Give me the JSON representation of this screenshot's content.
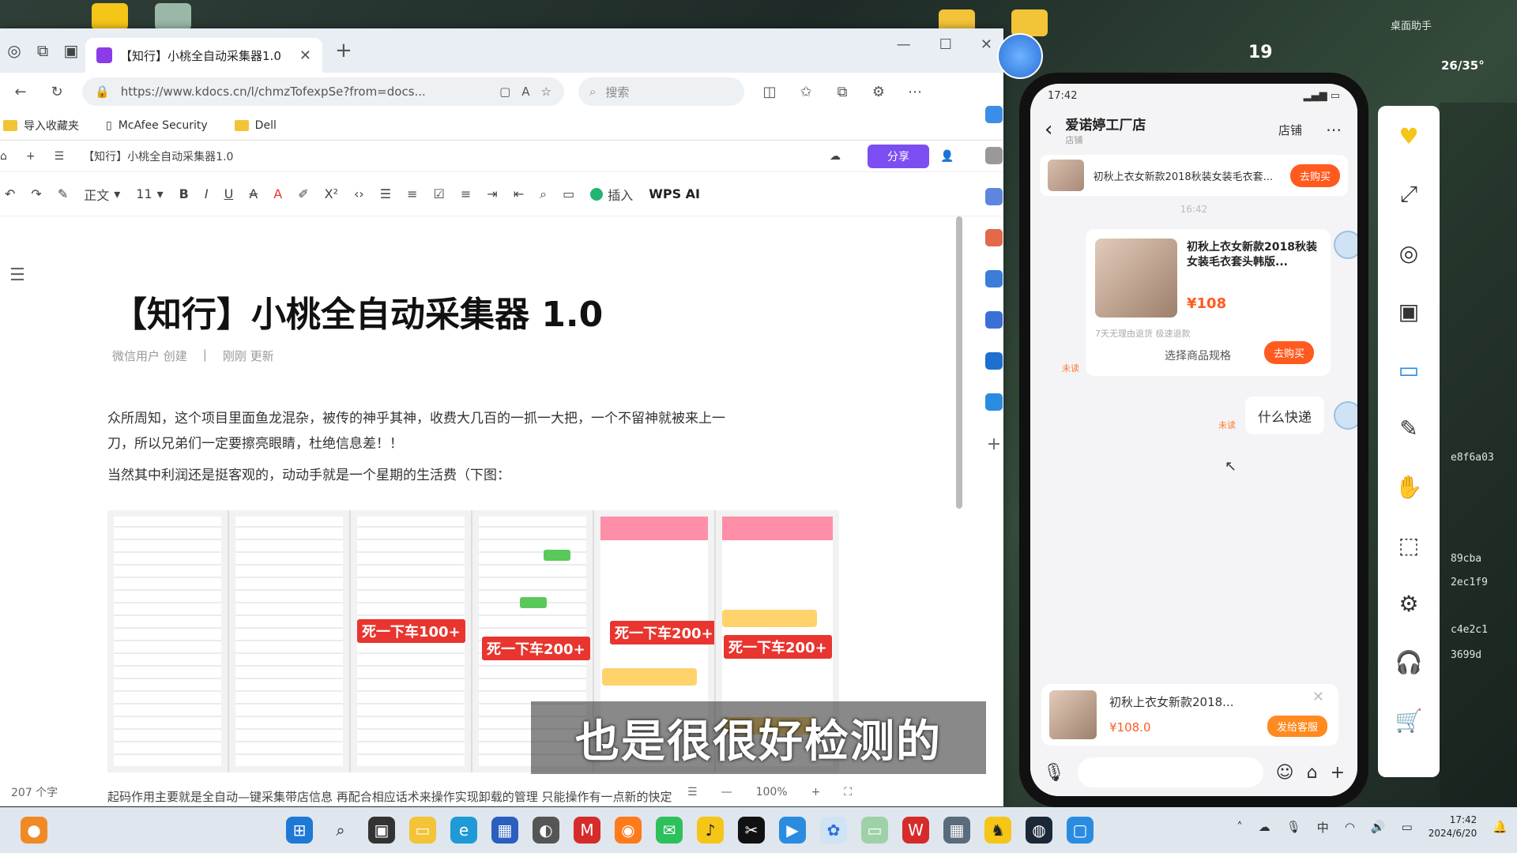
{
  "browser": {
    "tab_title": "【知行】小桃全自动采集器1.0",
    "url": "https://www.kdocs.cn/l/chmzTofexpSe?from=docs...",
    "search_placeholder": "搜索",
    "bookmarks": [
      "导入收藏夹",
      "McAfee Security",
      "Dell"
    ]
  },
  "doc": {
    "header_title": "【知行】小桃全自动采集器1.0",
    "share_label": "分享",
    "toolbar": {
      "style": "正文",
      "font_size": "11",
      "insert_label": "插入",
      "wps_ai_label": "WPS AI"
    },
    "title": "【知行】小桃全自动采集器 1.0",
    "meta_author": "微信用户 创建",
    "meta_updated": "刚刚 更新",
    "para1_line1": "众所周知，这个项目里面鱼龙混杂，被传的神乎其神，收费大几百的一抓一大把，一个不留神就被来上一",
    "para1_line2": "刀，所以兄弟们一定要擦亮眼睛，杜绝信息差！！",
    "para2": "当然其中利润还是挺客观的，动动手就是一个星期的生活费（下图：",
    "stamps": [
      "死一下车100+",
      "死一下车200+",
      "死一下车200+",
      "死一下车200+"
    ],
    "bottom_text": "起码作用主要就是全自动—键采集带店信息    再配合相应话术来操作实现卸载的管理    只能操作有一点新的快定",
    "word_count": "207 个字",
    "zoom": "100%"
  },
  "subtitle": "也是很很好检测的",
  "phone": {
    "time": "17:42",
    "shop_name": "爱诺婷工厂店",
    "shop_sub": "店铺",
    "store_label": "店铺",
    "product_bar_name": "初秋上衣女新款2018秋装女装毛衣套...",
    "buy_label": "去购买",
    "chat_time": "16:42",
    "card_name": "初秋上衣女新款2018秋装女装毛衣套头韩版...",
    "card_price": "¥108",
    "card_note": "7天无理由退货 极速退款",
    "card_spec": "选择商品规格",
    "unread_label": "未读",
    "question": "什么快递",
    "bottom_card_name": "初秋上衣女新款2018...",
    "bottom_card_price": "¥108.0",
    "send_label": "发给客服"
  },
  "desktop": {
    "weather_value": "19",
    "temp_range": "26/35°",
    "assistant_label": "桌面助手"
  },
  "taskbar": {
    "time": "17:42",
    "date": "2024/6/20",
    "ime": "中"
  }
}
